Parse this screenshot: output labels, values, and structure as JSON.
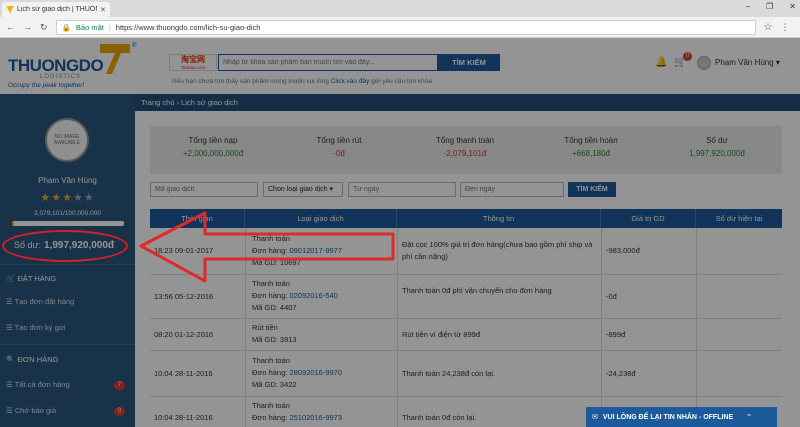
{
  "browser": {
    "tab_title": "Lịch sử giao dịch | THUONG",
    "secure_label": "Bảo mật",
    "url": "https://www.thuongdo.com/lich-su-giao-dich",
    "win_min": "–",
    "win_max": "❐",
    "win_close": "✕"
  },
  "header": {
    "logo_text": "THUONGDO",
    "logo_sub": "LOGISTICS",
    "logo_tag": "Occupy the peak together!",
    "logo_reg": "®",
    "taobao_label": "淘宝网",
    "taobao_sub": "Taobao.com",
    "search_placeholder": "Nhập từ khóa sản phẩm bạn muốn tìm vào đây...",
    "search_button": "TÌM KIẾM",
    "hint_text": "Nếu bạn chưa tìm thấy sản phẩm mong muốn vui lòng ",
    "hint_link": "Click vào đây",
    "hint_tail": " gửi yêu cầu tìm khóa",
    "cart_count": "0",
    "user_name": "Phạm Văn Hùng ▾"
  },
  "sidebar": {
    "avatar_text": "NO IMAGE AVAILABLE",
    "name": "Phạm Văn Hùng",
    "rating": 3,
    "rating_max": 5,
    "points": "2,079,101/100,000,000",
    "points_fraction": 0.02,
    "balance_label": "Số dư:",
    "balance_value": "1,997,920,000đ",
    "section_order": "ĐẶT HÀNG",
    "item_create_order": "Tạo đơn đặt hàng",
    "item_create_ship": "Tạo đơn ký gửi",
    "section_orders": "ĐƠN HÀNG",
    "item_all_orders": "Tất cả đơn hàng",
    "item_all_orders_count": "7",
    "item_waiting": "Chờ báo giá",
    "item_waiting_count": "0"
  },
  "breadcrumb": "Trang chủ  ›  Lịch sử giao dịch",
  "stats": [
    {
      "label": "Tổng tiền nạp",
      "value": "+2,000,000,000đ",
      "tone": "pos"
    },
    {
      "label": "Tổng tiền rút",
      "value": "-0đ",
      "tone": "neg"
    },
    {
      "label": "Tổng thanh toán",
      "value": "-2,079,101đ",
      "tone": "neg"
    },
    {
      "label": "Tổng tiền hoàn",
      "value": "+668,180đ",
      "tone": "pos"
    },
    {
      "label": "Số dư",
      "value": "1,997,920,000đ",
      "tone": "pos"
    }
  ],
  "filters": {
    "code_placeholder": "Mã giao dịch",
    "type_select": "Chon loại giao dịch ▾",
    "from_placeholder": "Từ ngày",
    "to_placeholder": "Đến ngày",
    "button": "TÌM KIẾM"
  },
  "table": {
    "headers": [
      "Thời gian",
      "Loại giao dịch",
      "Thông tin",
      "Giá trị GD",
      "Số dư hiện tại"
    ],
    "rows": [
      {
        "time": "18:23 09-01-2017",
        "type": "Thanh toán",
        "order_label": "Đơn hàng: ",
        "order": "09012017-9977",
        "code": "Mã GD: 10697",
        "info": "Đặt cọc 100% giá trị đơn hàng(chưa bao gồm phí ship và phí cân nặng)",
        "amount": "-983,000đ"
      },
      {
        "time": "13:56 05-12-2016",
        "type": "Thanh toán",
        "order_label": "Đơn hàng: ",
        "order": "02092016-540",
        "code": "Mã GD: 4407",
        "info": "Thanh toán 0đ phí vận chuyển cho đơn hàng",
        "amount": "-0đ"
      },
      {
        "time": "08:20 01-12-2016",
        "type": "Rút tiền",
        "order_label": "",
        "order": "",
        "code": "Mã GD: 3913",
        "info": "Rút tiền ví điện tử 899đ",
        "amount": "-899đ"
      },
      {
        "time": "10:04 28-11-2016",
        "type": "Thanh toán",
        "order_label": "Đơn hàng: ",
        "order": "28092016-9970",
        "code": "Mã GD: 3422",
        "info": "Thanh toán 24,238đ còn lại.",
        "amount": "-24,238đ"
      },
      {
        "time": "10:04 28-11-2016",
        "type": "Thanh toán",
        "order_label": "Đơn hàng: ",
        "order": "25102016-9973",
        "code": "",
        "info": "Thanh toán 0đ còn lại.",
        "amount": ""
      }
    ]
  },
  "chat_label": "VUI LÒNG ĐỂ LẠI TIN NHẮN - OFFLINE",
  "colors": {
    "brand": "#1d5a9b",
    "sidebar": "#2a567f",
    "highlight": "#d81f26",
    "negative": "#d32f2f",
    "positive": "#2e7d32"
  }
}
